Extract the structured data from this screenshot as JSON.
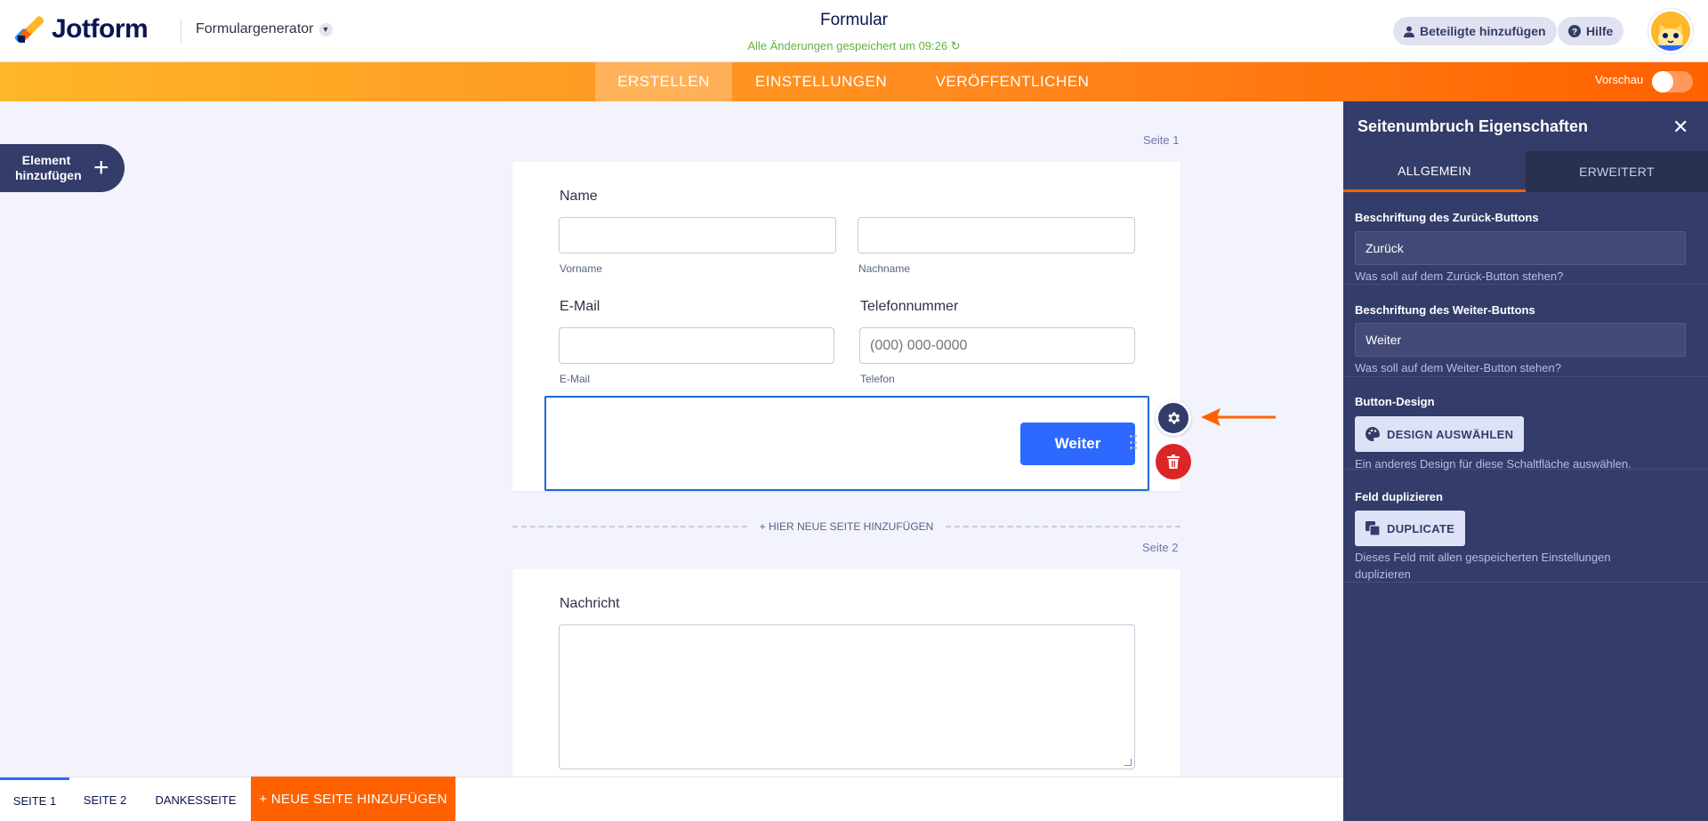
{
  "header": {
    "brand": "Jotform",
    "builder_label": "Formulargenerator",
    "form_title": "Formular",
    "saved_status": "Alle Änderungen gespeichert um 09:26",
    "invite_label": "Beteiligte hinzufügen",
    "help_label": "Hilfe"
  },
  "nav": {
    "tabs": [
      "ERSTELLEN",
      "EINSTELLUNGEN",
      "VERÖFFENTLICHEN"
    ],
    "active": "ERSTELLEN",
    "preview_label": "Vorschau",
    "preview_on": false
  },
  "add_element": {
    "label": "Element hinzufügen"
  },
  "form": {
    "page1_label": "Seite 1",
    "name_label": "Name",
    "first_sublabel": "Vorname",
    "last_sublabel": "Nachname",
    "email_label": "E-Mail",
    "email_sublabel": "E-Mail",
    "phone_label": "Telefonnummer",
    "phone_placeholder": "(000) 000-0000",
    "phone_sublabel": "Telefon",
    "next_button": "Weiter",
    "add_page_divider": "+ HIER NEUE SEITE HINZUFÜGEN",
    "page2_label": "Seite 2",
    "message_label": "Nachricht"
  },
  "pages_bar": {
    "tabs": [
      "SEITE 1",
      "SEITE 2",
      "DANKESSEITE"
    ],
    "active": "SEITE 1",
    "new_page": "+ NEUE SEITE HINZUFÜGEN"
  },
  "panel": {
    "title": "Seitenumbruch Eigenschaften",
    "tabs": [
      "ALLGEMEIN",
      "ERWEITERT"
    ],
    "active_tab": "ALLGEMEIN",
    "back_label_heading": "Beschriftung des Zurück-Buttons",
    "back_label_value": "Zurück",
    "back_label_help": "Was soll auf dem Zurück-Button stehen?",
    "next_label_heading": "Beschriftung des Weiter-Buttons",
    "next_label_value": "Weiter",
    "next_label_help": "Was soll auf dem Weiter-Button stehen?",
    "design_heading": "Button-Design",
    "design_button": "DESIGN AUSWÄHLEN",
    "design_help": "Ein anderes Design für diese Schaltfläche auswählen.",
    "duplicate_heading": "Feld duplizieren",
    "duplicate_button": "DUPLICATE",
    "duplicate_help": "Dieses Feld mit allen gespeicherten Einstellungen duplizieren"
  },
  "colors": {
    "accent_orange": "#ff6100",
    "primary_blue": "#2e69ff",
    "navy": "#343c6a",
    "delete_red": "#dc2626",
    "saved_green": "#64b242"
  }
}
